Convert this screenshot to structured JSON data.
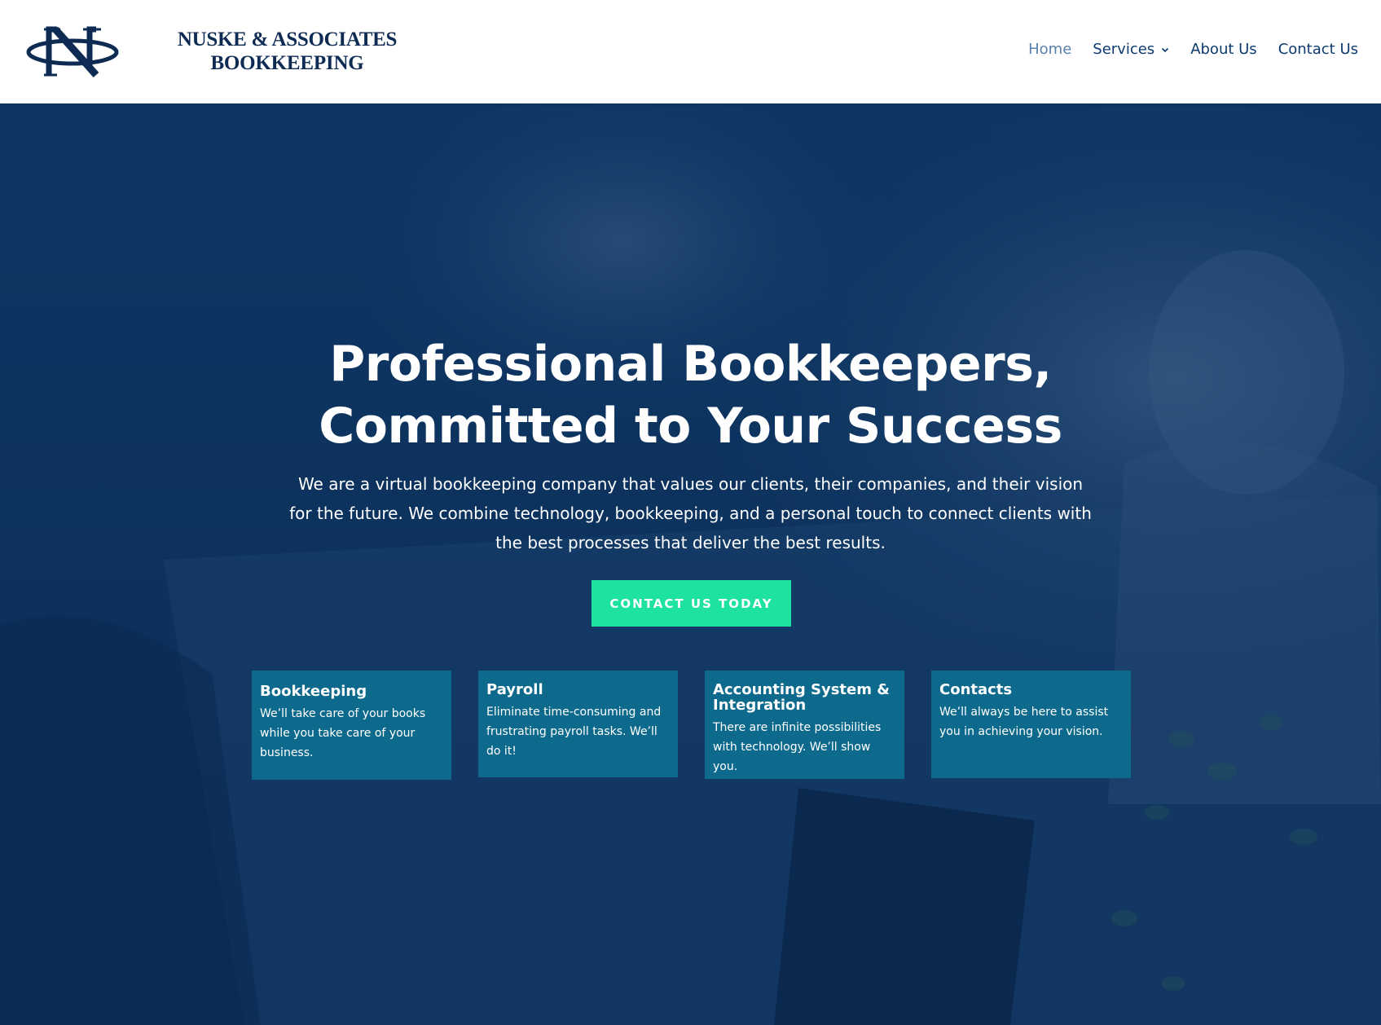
{
  "brand": {
    "name_line1": "NUSKE & ASSOCIATES",
    "name_line2": "BOOKKEEPING",
    "logo_icon": "n-monogram-logo-icon"
  },
  "nav": {
    "items": [
      {
        "label": "Home",
        "active": true
      },
      {
        "label": "Services",
        "has_dropdown": true
      },
      {
        "label": "About Us"
      },
      {
        "label": "Contact Us"
      }
    ]
  },
  "hero": {
    "title_line1": "Professional Bookkeepers,",
    "title_line2": "Committed to Your Success",
    "subtitle": "We are a virtual bookkeeping company that values our clients, their companies, and their vision for the future. We combine technology, bookkeeping, and a personal touch to connect clients with the best processes that deliver the best results.",
    "cta_label": "CONTACT US TODAY"
  },
  "cards": [
    {
      "title": "Bookkeeping",
      "text": "We’ll take care of your books while you take care of your business."
    },
    {
      "title": "Payroll",
      "text": "Eliminate time-consuming and frustrating payroll tasks. We’ll do it!"
    },
    {
      "title": "Accounting System & Integration",
      "text": "There are infinite possibilities with technology. We’ll show you."
    },
    {
      "title": "Contacts",
      "text": "We’ll always be here to assist you in achieving your vision."
    }
  ],
  "colors": {
    "navy": "#0d2b53",
    "nav_text": "#0d3a6e",
    "nav_active": "#5a7fa8",
    "hero_overlay": "#0a2d5a",
    "cta": "#1ee3a0",
    "card": "#0e6a8d"
  }
}
